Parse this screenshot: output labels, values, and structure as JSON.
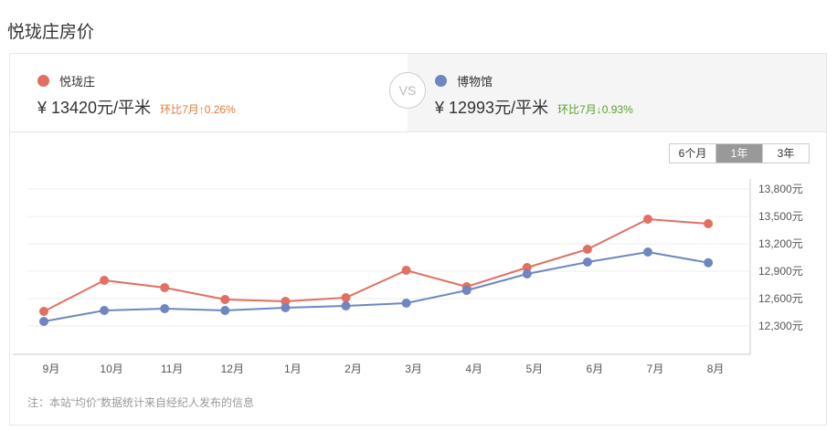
{
  "title": "悦珑庄房价",
  "left": {
    "name": "悦珑庄",
    "price": "¥ 13420元/平米",
    "change": "环比7月↑0.26%",
    "color": "#e07060",
    "change_color": "#e07a3a"
  },
  "vs": "VS",
  "right": {
    "name": "博物馆",
    "price": "¥ 12993元/平米",
    "change": "环比7月↓0.93%",
    "color": "#6f86c0",
    "change_color": "#5aa02c"
  },
  "range_buttons": [
    {
      "label": "6个月"
    },
    {
      "label": "1年",
      "active": true
    },
    {
      "label": "3年"
    }
  ],
  "note": "注：本站“均价”数据统计来自经纪人发布的信息",
  "chart_data": {
    "type": "line",
    "categories": [
      "9月",
      "10月",
      "11月",
      "12月",
      "1月",
      "2月",
      "3月",
      "4月",
      "5月",
      "6月",
      "7月",
      "8月"
    ],
    "series": [
      {
        "name": "悦珑庄",
        "color": "#e07060",
        "values": [
          12460,
          12800,
          12720,
          12590,
          12570,
          12610,
          12910,
          12730,
          12940,
          13140,
          13470,
          13420
        ]
      },
      {
        "name": "博物馆",
        "color": "#6f86c0",
        "values": [
          12350,
          12470,
          12490,
          12470,
          12500,
          12520,
          12550,
          12690,
          12870,
          13000,
          13110,
          12993
        ]
      }
    ],
    "yticks": [
      13800,
      13500,
      13200,
      12900,
      12600,
      12300
    ],
    "ytick_labels": [
      "13,800元",
      "13,500元",
      "13,200元",
      "12,900元",
      "12,600元",
      "12,300元"
    ],
    "ylim": [
      12000,
      13900
    ],
    "grid": true
  }
}
